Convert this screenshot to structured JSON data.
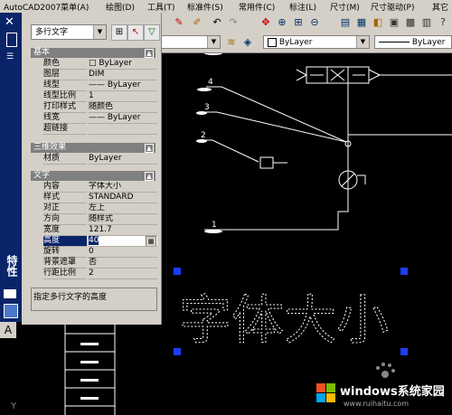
{
  "menubar": {
    "items": [
      "AutoCAD2007菜单(A)",
      "绘图(D)",
      "工具(T)",
      "标准件(S)",
      "常用件(C)",
      "标注(L)",
      "尺寸(M)",
      "尺寸驱动(P)",
      "其它"
    ]
  },
  "toolbar": {
    "layer_combo": "ByLayer",
    "linetype_combo": "ByLayer"
  },
  "palette": {
    "title_glyph": "特性",
    "object_type": "多行文字",
    "sections": {
      "basic": {
        "title": "基本",
        "rows": [
          {
            "label": "颜色",
            "value": "□ ByLayer"
          },
          {
            "label": "图层",
            "value": "DIM"
          },
          {
            "label": "线型",
            "value": "—— ByLayer"
          },
          {
            "label": "线型比例",
            "value": "1"
          },
          {
            "label": "打印样式",
            "value": "随颜色"
          },
          {
            "label": "线宽",
            "value": "—— ByLayer"
          },
          {
            "label": "超链接",
            "value": ""
          }
        ]
      },
      "three_d": {
        "title": "三维效果",
        "rows": [
          {
            "label": "材质",
            "value": "ByLayer"
          }
        ]
      },
      "text": {
        "title": "文字",
        "rows": [
          {
            "label": "内容",
            "value": "字体大小"
          },
          {
            "label": "样式",
            "value": "STANDARD"
          },
          {
            "label": "对正",
            "value": "左上"
          },
          {
            "label": "方向",
            "value": "随样式"
          },
          {
            "label": "宽度",
            "value": "121.7"
          },
          {
            "label": "高度",
            "value": "40"
          },
          {
            "label": "旋转",
            "value": "0"
          },
          {
            "label": "背景遮罩",
            "value": "否"
          },
          {
            "label": "行距比例",
            "value": "2"
          }
        ]
      }
    },
    "description": "指定多行文字的高度"
  },
  "drawing": {
    "callouts": [
      "4",
      "3",
      "2",
      "1"
    ],
    "dashed_text": "字体大小",
    "command_glyph": "A",
    "axis_glyph": "Y"
  },
  "watermark": {
    "title": "windows系统家园",
    "url": "www.ruihaitu.com"
  },
  "colors": {
    "window_title": "#0a246a",
    "panel": "#d4d0c8",
    "canvas": "#000000",
    "grip": "#1e3cff"
  }
}
